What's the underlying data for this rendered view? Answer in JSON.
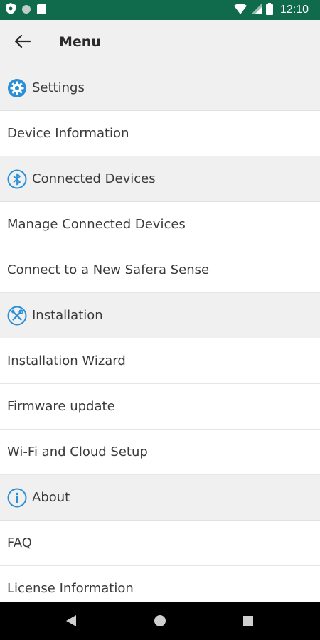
{
  "status_bar": {
    "time": "12:10",
    "icons": [
      "shield-icon",
      "circle-icon",
      "sim-card-icon",
      "wifi-icon",
      "signal-icon",
      "battery-icon"
    ]
  },
  "header": {
    "title": "Menu",
    "back_icon": "arrow-left-icon"
  },
  "sections": [
    {
      "label": "Settings",
      "icon": "gear-icon",
      "items": [
        "Device Information"
      ]
    },
    {
      "label": "Connected Devices",
      "icon": "bluetooth-icon",
      "items": [
        "Manage Connected Devices",
        "Connect to a New Safera Sense"
      ]
    },
    {
      "label": "Installation",
      "icon": "tools-icon",
      "items": [
        "Installation Wizard",
        "Firmware update",
        "Wi-Fi and Cloud Setup"
      ]
    },
    {
      "label": "About",
      "icon": "info-icon",
      "items": [
        "FAQ",
        "License Information"
      ]
    }
  ],
  "nav_bar": {
    "icons": [
      "back-triangle-icon",
      "home-circle-icon",
      "recents-square-icon"
    ]
  },
  "colors": {
    "status_bar": "#0f6b4b",
    "accent": "#2a8fd6",
    "background": "#f0f0f0",
    "item_background": "#ffffff",
    "text": "#3a3a3a"
  }
}
